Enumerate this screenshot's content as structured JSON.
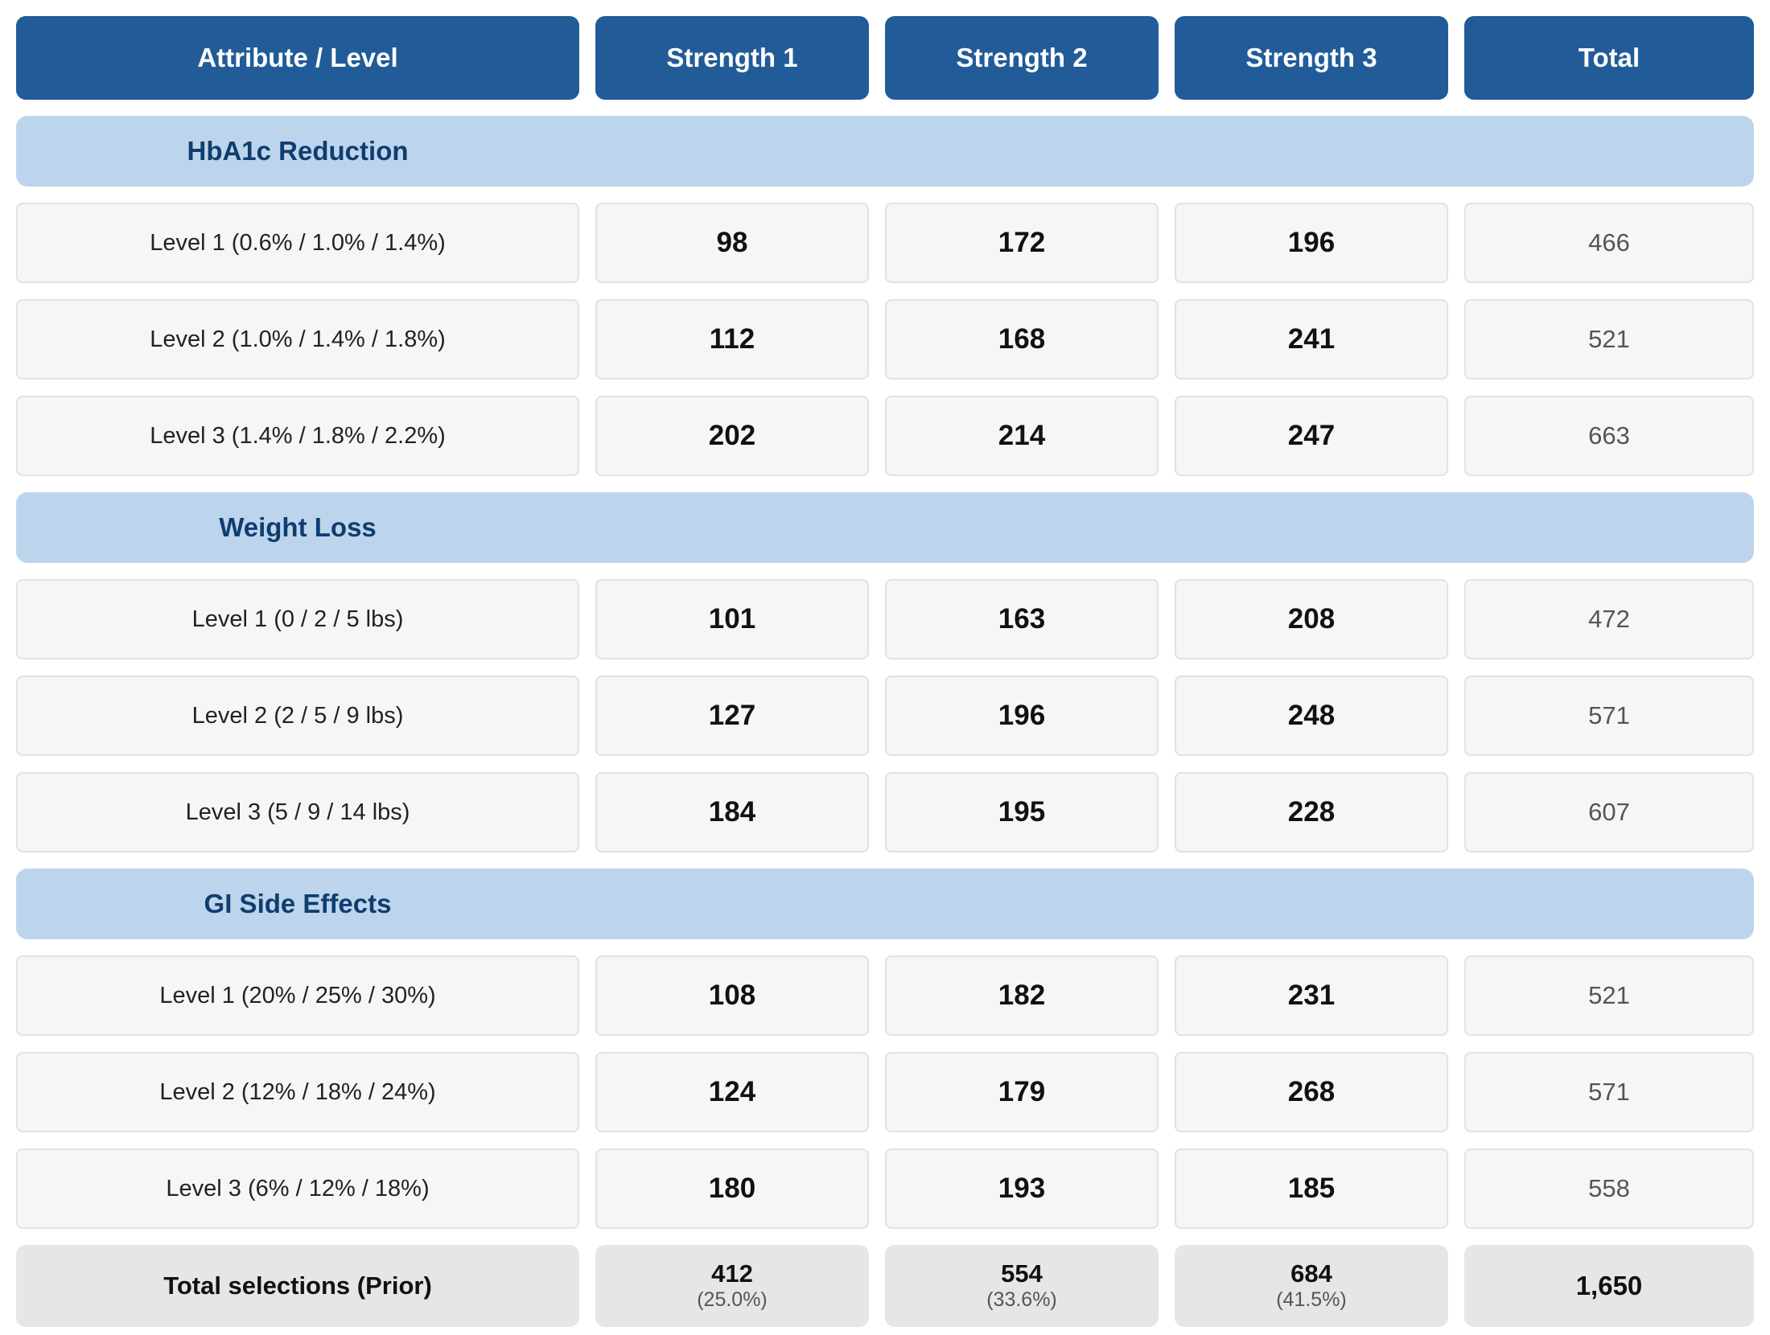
{
  "header": {
    "col_attribute": "Attribute / Level",
    "col_s1": "Strength 1",
    "col_s2": "Strength 2",
    "col_s3": "Strength 3",
    "col_total": "Total"
  },
  "sections": [
    {
      "title": "HbA1c Reduction",
      "rows": [
        {
          "label": "Level 1 (0.6% / 1.0% / 1.4%)",
          "s1": "98",
          "s2": "172",
          "s3": "196",
          "total": "466"
        },
        {
          "label": "Level 2 (1.0% / 1.4% / 1.8%)",
          "s1": "112",
          "s2": "168",
          "s3": "241",
          "total": "521"
        },
        {
          "label": "Level 3 (1.4% / 1.8% / 2.2%)",
          "s1": "202",
          "s2": "214",
          "s3": "247",
          "total": "663"
        }
      ]
    },
    {
      "title": "Weight Loss",
      "rows": [
        {
          "label": "Level 1 (0 / 2 / 5 lbs)",
          "s1": "101",
          "s2": "163",
          "s3": "208",
          "total": "472"
        },
        {
          "label": "Level 2 (2 / 5 / 9 lbs)",
          "s1": "127",
          "s2": "196",
          "s3": "248",
          "total": "571"
        },
        {
          "label": "Level 3 (5 / 9 / 14 lbs)",
          "s1": "184",
          "s2": "195",
          "s3": "228",
          "total": "607"
        }
      ]
    },
    {
      "title": "GI Side Effects",
      "rows": [
        {
          "label": "Level 1 (20% / 25% / 30%)",
          "s1": "108",
          "s2": "182",
          "s3": "231",
          "total": "521"
        },
        {
          "label": "Level 2 (12% / 18% / 24%)",
          "s1": "124",
          "s2": "179",
          "s3": "268",
          "total": "571"
        },
        {
          "label": "Level 3 (6% / 12% / 18%)",
          "s1": "180",
          "s2": "193",
          "s3": "185",
          "total": "558"
        }
      ]
    }
  ],
  "totals": {
    "label": "Total selections (Prior)",
    "s1": "412",
    "s1_pct": "(25.0%)",
    "s2": "554",
    "s2_pct": "(33.6%)",
    "s3": "684",
    "s3_pct": "(41.5%)",
    "grand": "1,650"
  },
  "colors": {
    "header_bg": "#215c98",
    "section_bg": "#bdd5ec",
    "section_text": "#0f3d70",
    "cell_bg": "#f6f6f6",
    "total_row_bg": "#e6e6e6"
  }
}
